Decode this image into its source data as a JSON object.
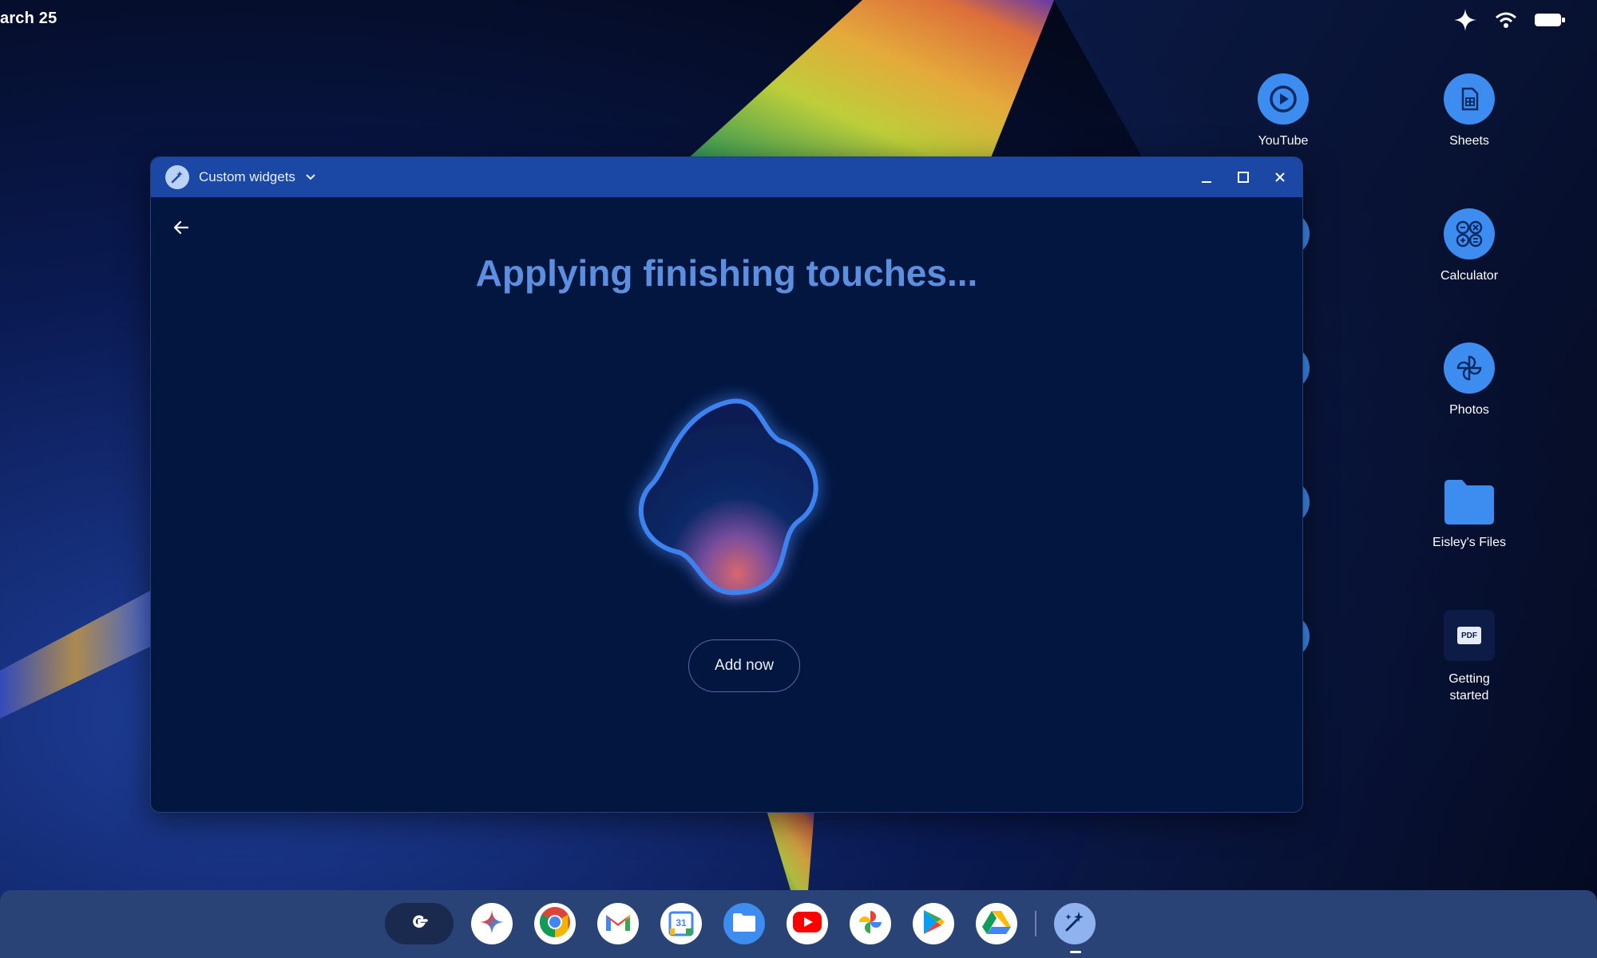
{
  "status_bar": {
    "date": "arch 25"
  },
  "desktop": {
    "items": [
      {
        "label": "YouTube",
        "icon": "youtube-play-icon"
      },
      {
        "label": "Sheets",
        "icon": "sheets-icon"
      },
      {
        "label": "Calculator",
        "icon": "calculator-icon"
      },
      {
        "label": "Photos",
        "icon": "photos-pinwheel-icon"
      },
      {
        "label": "Eisley's Files",
        "icon": "folder-icon"
      },
      {
        "label": "Getting started",
        "icon": "pdf-icon"
      }
    ]
  },
  "window": {
    "title": "Custom widgets",
    "heading": "Applying finishing touches...",
    "add_button": "Add now",
    "colors": {
      "titlebar": "#1a48a4",
      "body": "#031640",
      "heading": "#5d8fe0"
    }
  },
  "shelf": {
    "apps": [
      "Launcher",
      "Gemini",
      "Chrome",
      "Gmail",
      "Calendar",
      "Files",
      "YouTube",
      "Photos",
      "Play Store",
      "Drive",
      "Custom widgets"
    ],
    "calendar_day": "31",
    "pdf_text": "PDF"
  }
}
